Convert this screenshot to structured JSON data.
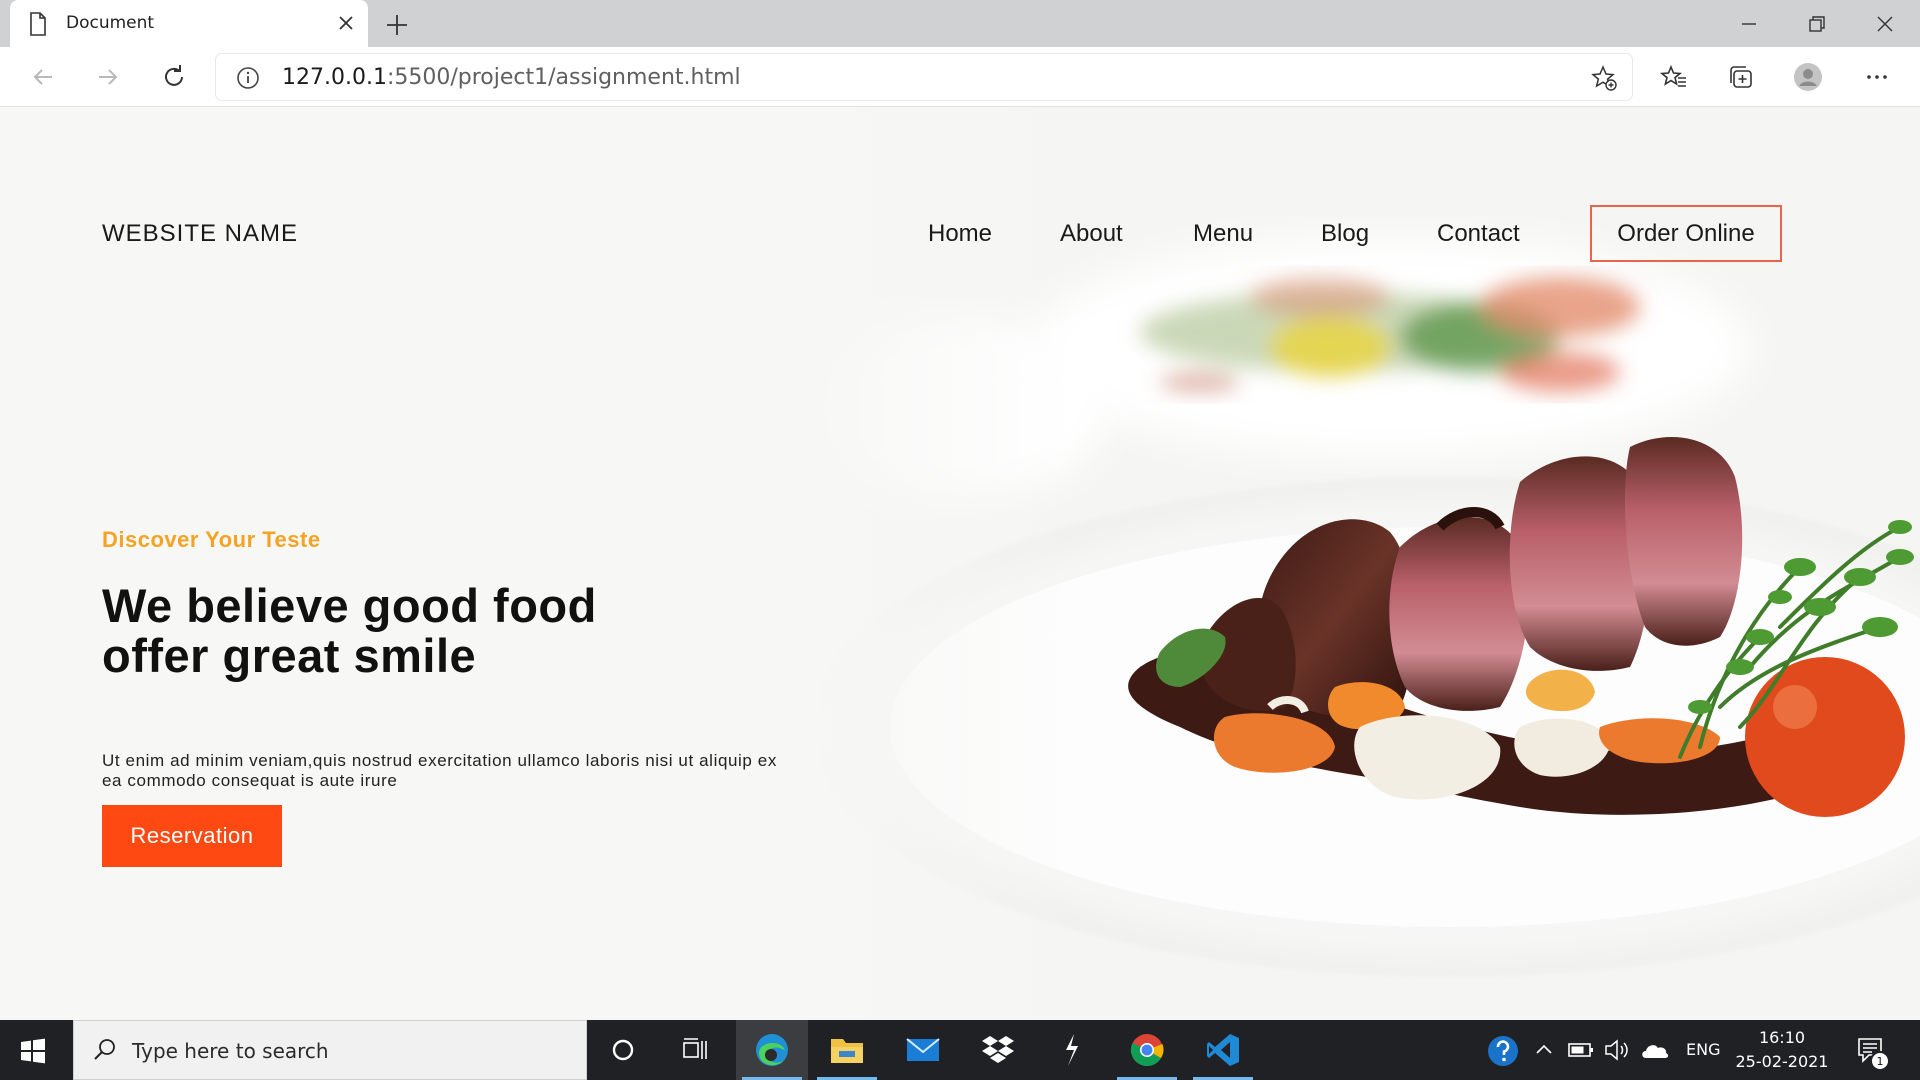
{
  "browser": {
    "tab_title": "Document",
    "url_host": "127.0.0.1",
    "url_rest": ":5500/project1/assignment.html"
  },
  "page": {
    "site_name": "WEBSITE NAME",
    "nav": [
      "Home",
      "About",
      "Menu",
      "Blog",
      "Contact"
    ],
    "order_button": "Order Online",
    "kicker": "Discover Your Teste",
    "headline_lines": [
      "We believe good food",
      "offer great smile"
    ],
    "body": "Ut enim ad minim veniam,quis nostrud exercitation ullamco laboris nisi ut aliquip ex ea commodo consequat is aute irure",
    "reservation_button": "Reservation"
  },
  "colors": {
    "accent_orange": "#fe4a12",
    "kicker_yellow": "#f4a324",
    "order_border": "#e8654a"
  },
  "taskbar": {
    "search_placeholder": "Type here to search",
    "apps": [
      "cortana-icon",
      "task-view-icon",
      "edge-icon",
      "file-explorer-icon",
      "mail-icon",
      "dropbox-icon",
      "app-icon",
      "chrome-icon",
      "vscode-icon"
    ],
    "language": "ENG",
    "time": "16:10",
    "date": "25-02-2021",
    "notification_count": "1"
  }
}
